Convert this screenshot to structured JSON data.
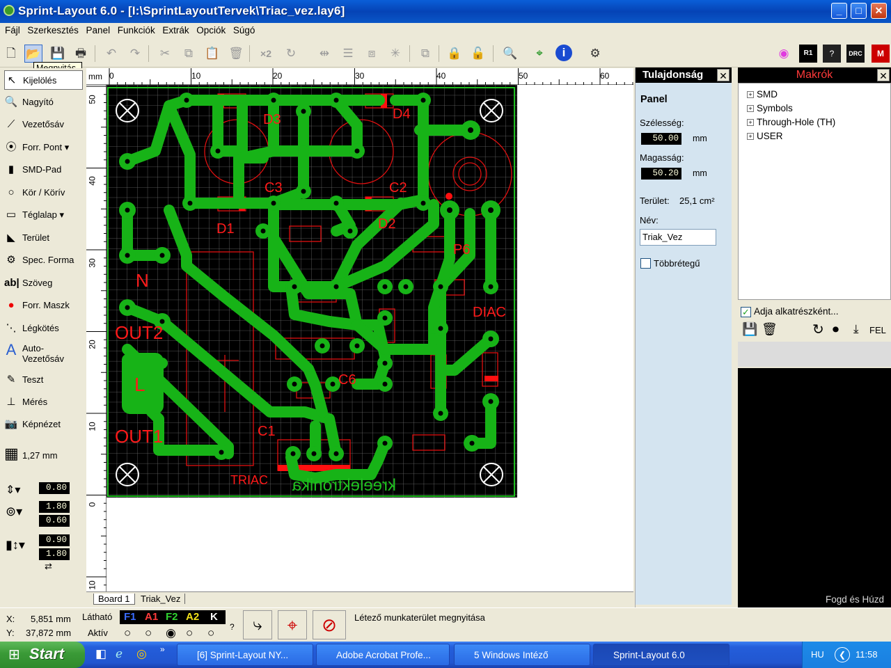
{
  "window": {
    "title": "Sprint-Layout 6.0 - [I:\\SprintLayoutTervek\\Triac_vez.lay6]",
    "min": "_",
    "max": "□",
    "close": "✕"
  },
  "menu": [
    "Fájl",
    "Szerkesztés",
    "Panel",
    "Funkciók",
    "Extrák",
    "Opciók",
    "Súgó"
  ],
  "tooltip": "Megnyitás",
  "tools": [
    {
      "label": "Kijelölés",
      "icon": "pointer-icon"
    },
    {
      "label": "Nagyító",
      "icon": "magnifier-icon"
    },
    {
      "label": "Vezetősáv",
      "icon": "track-icon"
    },
    {
      "label": "Forr. Pont",
      "icon": "pad-icon"
    },
    {
      "label": "SMD-Pad",
      "icon": "smd-pad-icon"
    },
    {
      "label": "Kör / Körív",
      "icon": "circle-icon"
    },
    {
      "label": "Téglalap",
      "icon": "rectangle-icon"
    },
    {
      "label": "Terület",
      "icon": "zone-icon"
    },
    {
      "label": "Spec. Forma",
      "icon": "special-form-icon"
    },
    {
      "label": "Szöveg",
      "icon": "text-icon"
    },
    {
      "label": "Forr. Maszk",
      "icon": "solder-mask-icon"
    },
    {
      "label": "Légkötés",
      "icon": "airwire-icon"
    },
    {
      "label": "Auto-Vezetősáv",
      "icon": "autoroute-icon"
    },
    {
      "label": "Teszt",
      "icon": "test-icon"
    },
    {
      "label": "Mérés",
      "icon": "measure-icon"
    },
    {
      "label": "Képnézet",
      "icon": "photoview-icon"
    }
  ],
  "grid_label": "1,27 mm",
  "track_width": "0.80",
  "pad_outer": "1.80",
  "pad_inner": "0.60",
  "smd_w": "0.90",
  "smd_h": "1.80",
  "ruler": {
    "unit": "mm",
    "top_ticks": [
      "0",
      "10",
      "20",
      "30",
      "40",
      "50",
      "60"
    ],
    "left_ticks": [
      "50",
      "40",
      "30",
      "20",
      "10",
      "0",
      "10"
    ]
  },
  "pcb_labels": [
    "D3",
    "D4",
    "C3",
    "C2",
    "D1",
    "D2",
    "P6",
    "N",
    "OUT2",
    "DIAC",
    "L",
    "C6",
    "OUT1",
    "C1",
    "TRIAC",
    "kreelektronika"
  ],
  "tabs": [
    "Board 1",
    "Triak_Vez"
  ],
  "properties": {
    "header": "Tulajdonság",
    "section": "Panel",
    "width_label": "Szélesség:",
    "width_value": "50.00",
    "height_label": "Magasság:",
    "height_value": "50.20",
    "unit": "mm",
    "area_label": "Terület:",
    "area_value": "25,1 cm²",
    "name_label": "Név:",
    "name_value": "Triak_Vez",
    "multilayer_label": "Többrétegű"
  },
  "macros": {
    "header": "Makrók",
    "tree": [
      "SMD",
      "Symbols",
      "Through-Hole (TH)",
      "USER"
    ],
    "add_as_component": "Adja alkatrészként...",
    "up_label": "FEL",
    "drag_hint": "Fogd és Húzd"
  },
  "status": {
    "x_label": "X:",
    "x_value": "5,851 mm",
    "y_label": "Y:",
    "y_value": "37,872 mm",
    "visible": "Látható",
    "active": "Aktív",
    "layers": [
      "F1",
      "A1",
      "F2",
      "A2",
      "K"
    ],
    "layer_colors": [
      "#3a6cff",
      "#ff3b3b",
      "#31d431",
      "#f3e21a",
      "#ffffff"
    ],
    "help": "?",
    "message": "Létező munkaterület megnyitása"
  },
  "taskbar": {
    "start": "Start",
    "tasks": [
      "[6] Sprint-Layout NY...",
      "Adobe Acrobat Profe...",
      "5 Windows Intéző",
      "Sprint-Layout 6.0"
    ],
    "lang": "HU",
    "time": "11:58"
  }
}
